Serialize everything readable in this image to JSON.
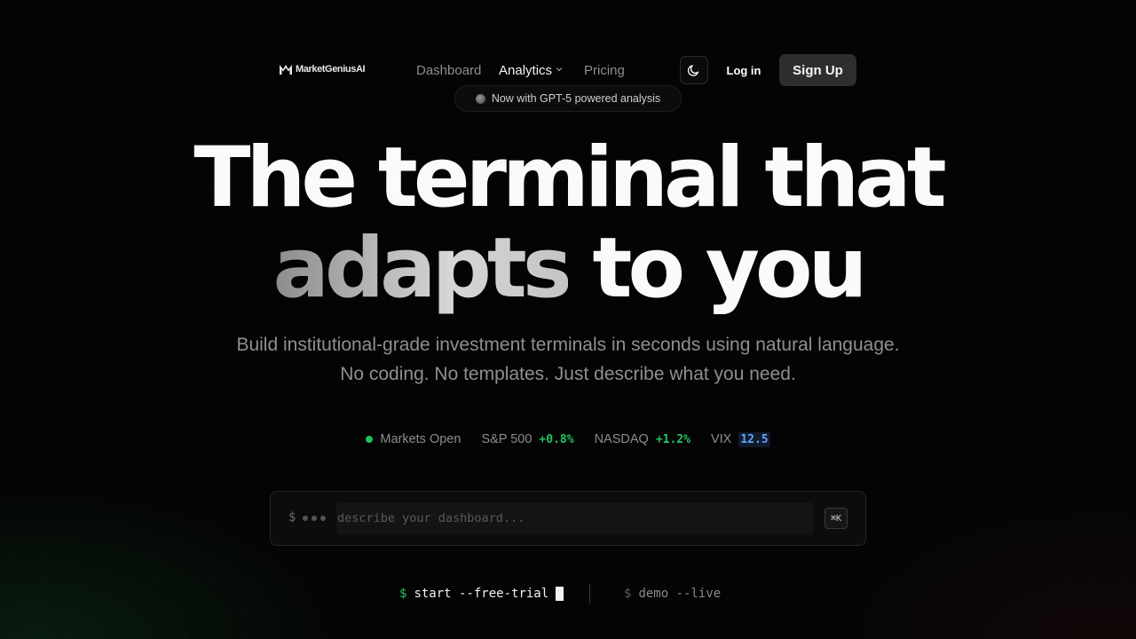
{
  "nav": {
    "logo_text": "MarketGeniusAI",
    "links": [
      {
        "label": "Dashboard"
      },
      {
        "label": "Analytics",
        "has_dropdown": true,
        "active": true
      },
      {
        "label": "Pricing"
      }
    ],
    "theme_icon": "moon-icon",
    "login_label": "Log in",
    "signup_label": "Sign Up"
  },
  "badge": {
    "text": "Now with GPT-5 powered analysis"
  },
  "hero": {
    "line1": "The terminal that",
    "line2_highlight": "adapts",
    "line2_rest": "to you",
    "subtitle_line1": "Build institutional-grade investment terminals in seconds using natural language.",
    "subtitle_line2": "No coding. No templates. Just describe what you need."
  },
  "market": {
    "status": "Markets Open",
    "status_color": "#18c35c",
    "tickers": [
      {
        "name": "S&P 500",
        "value": "+0.8%",
        "color": "#22c55e"
      },
      {
        "name": "NASDAQ",
        "value": "+1.2%",
        "color": "#22c55e"
      },
      {
        "name": "VIX",
        "value": "12.5",
        "color": "#60a5fa"
      }
    ]
  },
  "terminal": {
    "prompt": "$",
    "placeholder": "describe your dashboard...",
    "value": "",
    "shortcut": "⌘K"
  },
  "cta": {
    "primary_sign": "$",
    "primary_cmd": "start --free-trial",
    "secondary_sign": "$",
    "secondary_cmd": "demo --live"
  }
}
